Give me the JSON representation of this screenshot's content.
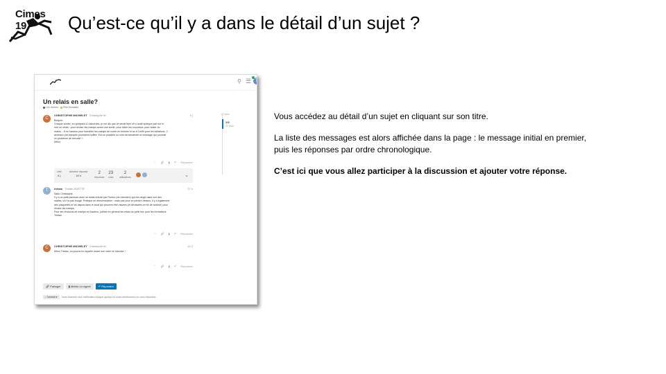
{
  "slide": {
    "logo_text": "Cimes 19",
    "title": "Qu’est-ce qu’il y a dans le détail d’un sujet ?",
    "paragraphs": {
      "p1": "Vous accédez au détail d’un sujet en cliquant sur son titre.",
      "p2a": "La liste des messages est alors affichée dans la page : le message initial en premier,",
      "p2b": "puis les réponses par ordre chronologique.",
      "p3": "C’est ici que vous allez participer à la discussion  et ajouter votre réponse."
    }
  },
  "forum": {
    "header": {
      "search_icon": "search-icon",
      "menu_icon": "hamburger-icon",
      "avatar_letter": "T"
    },
    "topic_title": "Un relais en salle?",
    "categories": [
      {
        "label": "Les Jeûnes",
        "color": "#7a3c8c"
      },
      {
        "label": "Pôle Escalade",
        "color": "#e0b23a"
      }
    ],
    "timeline": {
      "date_top": "22 janv.",
      "count": "1/3",
      "date_bottom": "22 janv."
    },
    "posts": [
      {
        "author": "CHRISTOPHE MICHELET",
        "username": "Christophe M",
        "date": "8 j",
        "avatar_letter": "C",
        "lines": [
          "Bonjour,",
          "Chaque année, en grimpant à Lasbordes, je me dis que ce serait bien s'il y avait quelque part sur le",
          "mur un relais : pour réviser les manips avant une sortie, pour initier les nouveaux, pour tester du",
          "matos... À mi hauteur pour travailler les manips de corde en binôme et au à 1m50 pour les initiations, 2",
          "anneaux pré-équipés pourraient suffire. Est-ce possible ou cela demanderait un bricolage qui pourrait",
          "un problème de sécurité ?",
          "Merci."
        ],
        "reply_label": "Répondre"
      },
      {
        "author": "tristan",
        "username": "Tristan ADETTE",
        "date": "22 h",
        "avatar_letter": "T",
        "lines": [
          "Salut Christophe,",
          "Il y a un petit panneau avec un relais bricolé par Florine (de mémoire) qui est rangé dans une des",
          "malles, s'il n'a pas bougé. Pratique en démonstration ; mais pas pour se pendre dessus. Il y a également",
          "des plaquettes et vis dispos dans le local qui peuvent être vissées (et dévissées en fin de séance) pour",
          "réviser les manips.",
          "Pour les révisions de manips en hauteur, j'utilise en général les relais du petit mur pour les formations.",
          "Tristan"
        ],
        "reply_label": "Répondre"
      },
      {
        "author": "CHRISTOPHE MICHELET",
        "username": "Christophe M",
        "date": "18 h",
        "avatar_letter": "C",
        "lines": [
          "Merci Tristan, on pourra en reparler avant une virée en Vanoise !"
        ],
        "reply_label": "Répondre"
      }
    ],
    "summary": {
      "created_label": "créé",
      "created_value": "8 j",
      "last_label": "dernière réponse",
      "last_value": "18 h",
      "replies": "2",
      "replies_label": "réponses",
      "views": "23",
      "views_label": "vues",
      "users": "2",
      "users_label": "utilisateurs"
    },
    "buttons": {
      "share": "Partager",
      "bookmark": "Mettre un signet",
      "reply": "Répondre"
    },
    "notification": {
      "level": "Normal",
      "text": "Vous recevrez une notification lorsque quelqu'un vous mentionnera ou vous répondra."
    },
    "colors": {
      "primary": "#0a73b5",
      "avatar_c": "#c9713d",
      "avatar_t": "#8eb2d6"
    }
  }
}
